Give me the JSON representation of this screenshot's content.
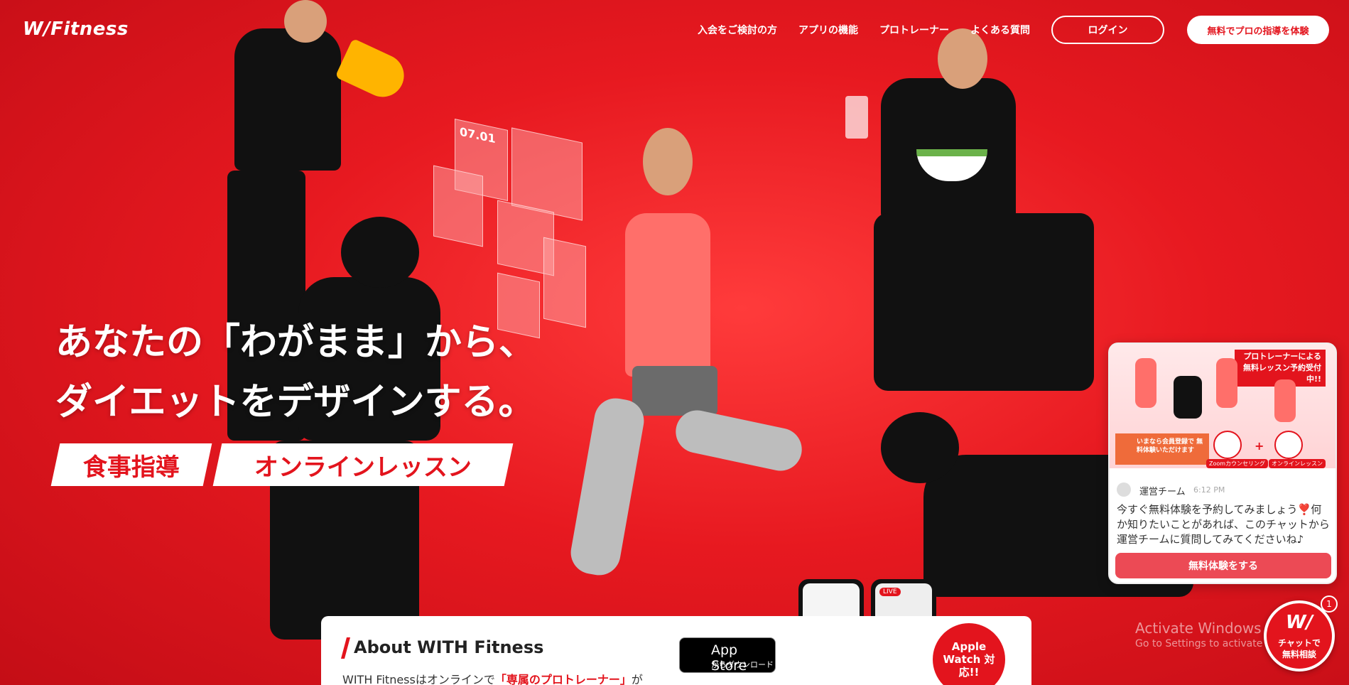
{
  "header": {
    "logo": "W/Fitness",
    "nav": [
      "入会をご検討の方",
      "アプリの機能",
      "プロトレーナー",
      "よくある質問"
    ],
    "login_label": "ログイン",
    "trial_label": "無料でプロの指導を体験"
  },
  "hero": {
    "headline_line1": "あなたの「わがまま」から、",
    "headline_line2": "ダイエットをデザインする。",
    "tags": [
      "食事指導",
      "オンラインレッスン"
    ],
    "holo_date": "07.01"
  },
  "about": {
    "title": "About WITH Fitness",
    "text_before": "WITH Fitnessはオンラインで",
    "text_highlight": "「専属のプロトレーナー」",
    "text_after": "が",
    "appstore_title": "App Store",
    "appstore_sub": "からダウンロード",
    "watch_badge": "Apple Watch 対応!!",
    "phone_live": "LIVE"
  },
  "chat": {
    "banner_title": "プロトレーナーによる 無料レッスン予約受付中!!",
    "promo": "いまなら会員登録で 無料体験いただけます",
    "label_zoom": "Zoomカウンセリング",
    "label_lesson": "オンラインレッスン",
    "sender": "運営チーム",
    "time": "6:12 PM",
    "message": "今すぐ無料体験を予約してみましょう❣️何か知りたいことがあれば、このチャットから運営チームに質問してみてくださいね♪",
    "button": "無料体験をする"
  },
  "fab": {
    "logo": "W/",
    "label": "チャットで 無料相談",
    "count": "1"
  },
  "watermark": {
    "title": "Activate Windows",
    "sub": "Go to Settings to activate Windows."
  },
  "colors": {
    "brand": "#e3141d",
    "white": "#ffffff"
  }
}
